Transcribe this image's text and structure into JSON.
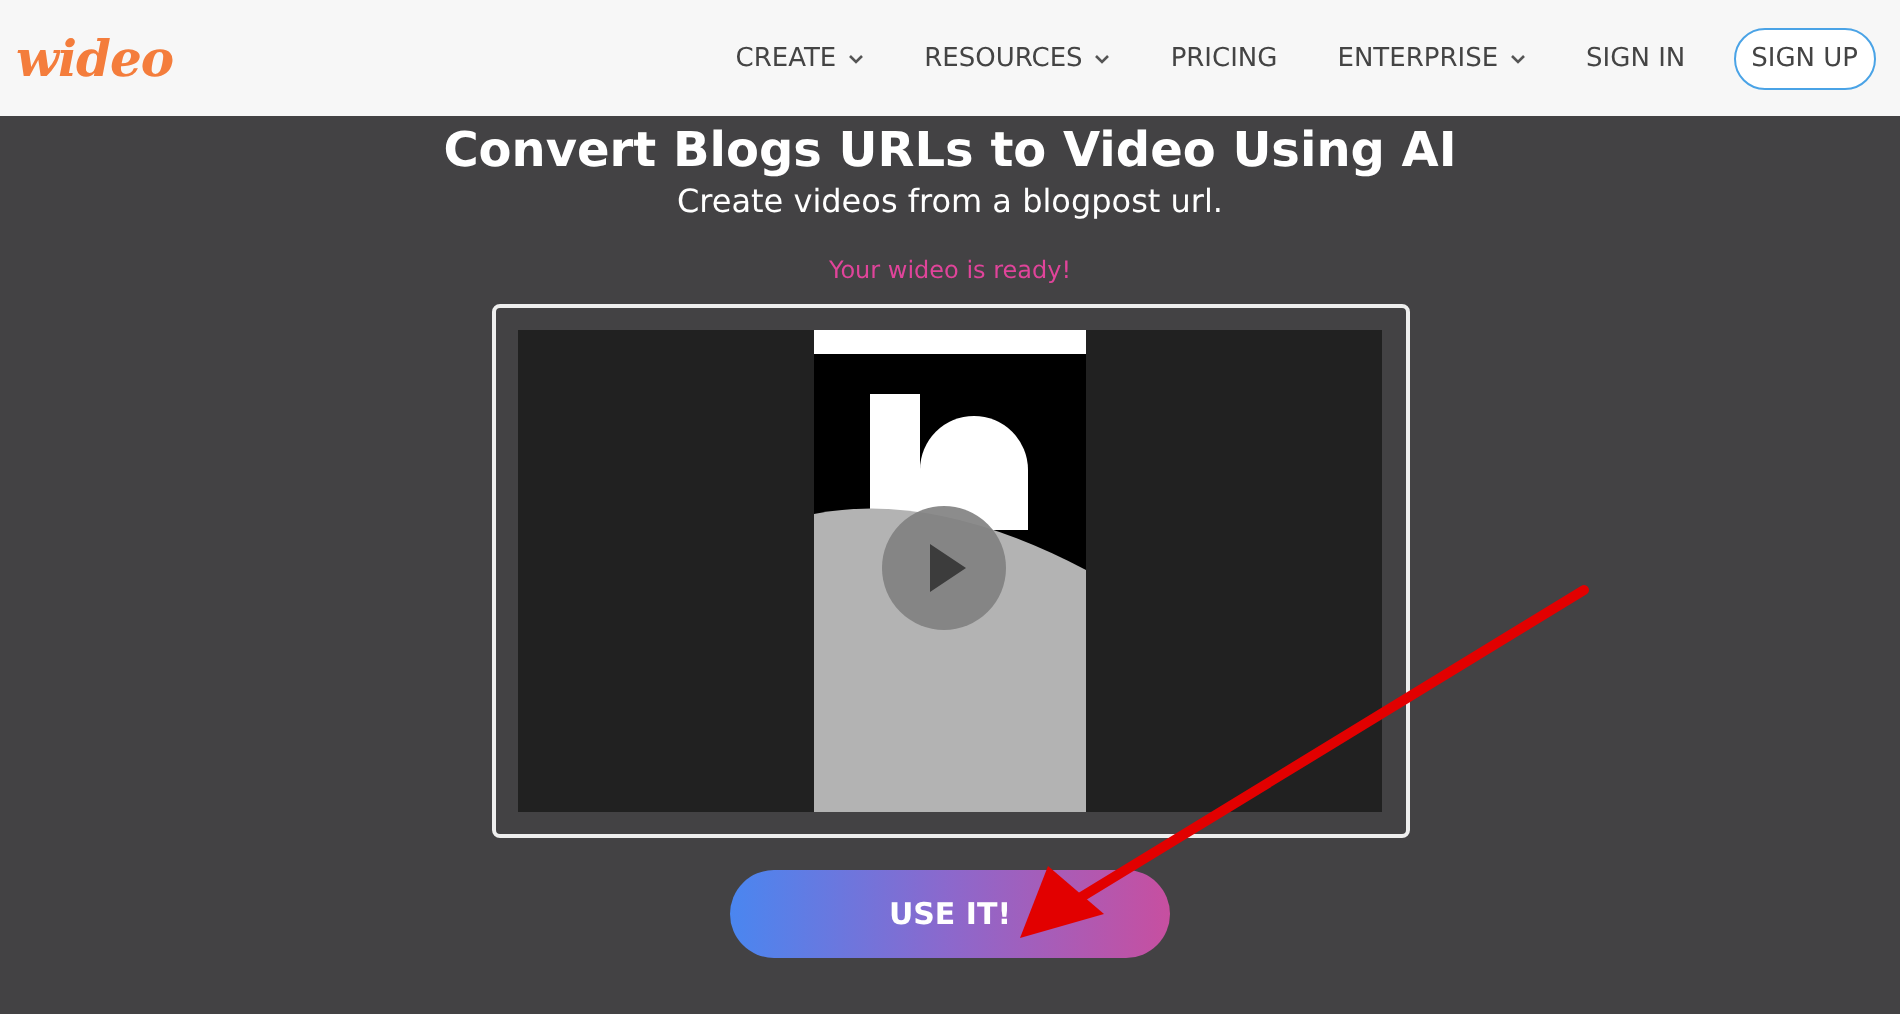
{
  "header": {
    "logo": "wideo",
    "nav": [
      {
        "label": "CREATE",
        "dropdown": true
      },
      {
        "label": "RESOURCES",
        "dropdown": true
      },
      {
        "label": "PRICING",
        "dropdown": false
      },
      {
        "label": "ENTERPRISE",
        "dropdown": true
      },
      {
        "label": "SIGN IN",
        "dropdown": false
      }
    ],
    "signup": "SIGN UP"
  },
  "hero": {
    "title": "Convert Blogs URLs to Video Using AI",
    "subtitle": "Create videos from a blogpost url."
  },
  "result": {
    "status": "Your wideo is ready!",
    "button": "USE IT!"
  }
}
